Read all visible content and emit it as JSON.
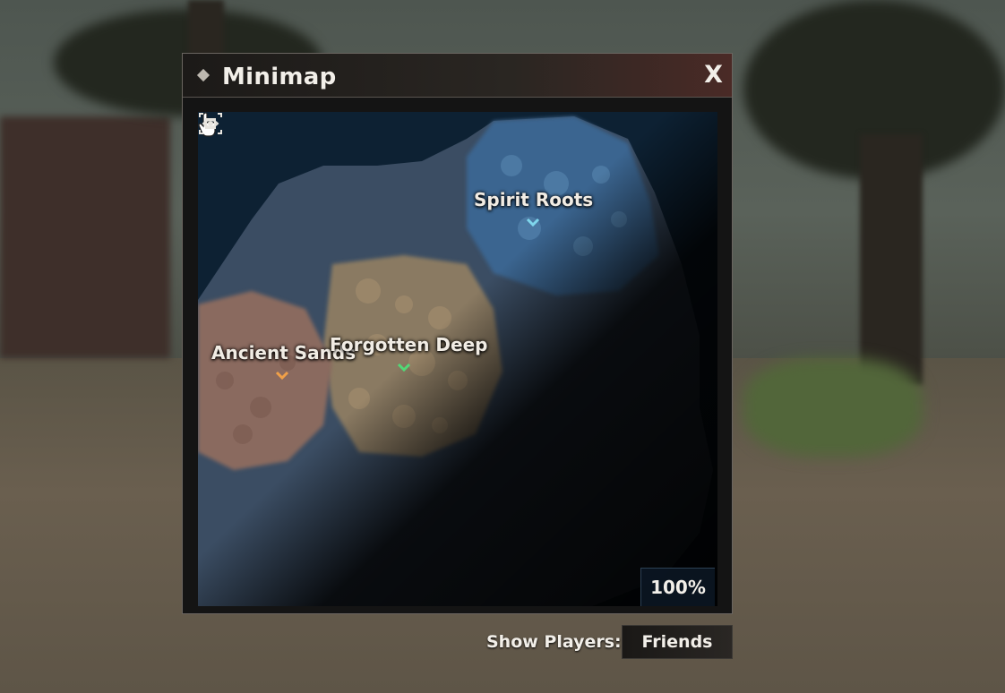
{
  "window": {
    "title": "Minimap",
    "close_label": "X"
  },
  "map": {
    "regions": [
      {
        "name": "Spirit Roots",
        "marker_color": "#7fd6ec"
      },
      {
        "name": "Ancient Sands",
        "marker_color": "#f0a048"
      },
      {
        "name": "Forgotten Deep",
        "marker_color": "#52d876"
      }
    ],
    "zoom_level": "100%",
    "icons": {
      "visibility": "eye-icon",
      "recenter": "recenter-icon",
      "cursor": "hand-pointer-icon"
    }
  },
  "show_players": {
    "label": "Show Players:",
    "value": "Friends"
  },
  "colors": {
    "accent_title_bar": "#4a2a26",
    "map_water": "#0d2133"
  }
}
